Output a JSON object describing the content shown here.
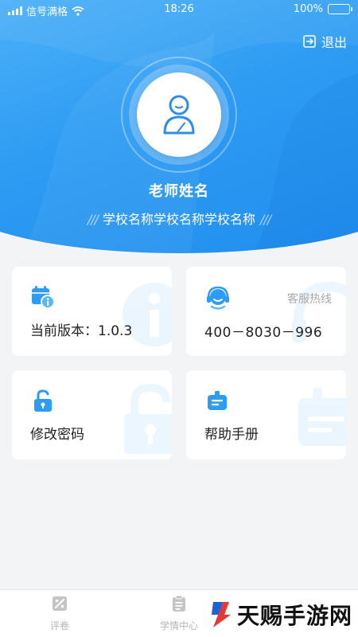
{
  "statusbar": {
    "carrier": "信号满格",
    "time": "18:26",
    "battery": "100%"
  },
  "header": {
    "logout_label": "退出",
    "teacher_name": "老师姓名",
    "school_name": "学校名称学校名称学校名称",
    "slashes_left": "///",
    "slashes_right": "///"
  },
  "cards": {
    "version": {
      "label": "当前版本：1.0.3"
    },
    "hotline": {
      "hint": "客服热线",
      "phone": "400－8030－996"
    },
    "password": {
      "label": "修改密码"
    },
    "manual": {
      "label": "帮助手册"
    }
  },
  "bottom_nav": {
    "items": [
      {
        "label": "评卷",
        "icon": "grading-icon"
      },
      {
        "label": "学情中心",
        "icon": "clipboard-icon"
      }
    ]
  },
  "watermark": {
    "brand_text": "天赐手游网"
  },
  "colors": {
    "primary": "#2e9cf3",
    "card_bg": "#ffffff",
    "page_bg": "#f3f4f6",
    "text_dark": "#222222",
    "text_muted": "#a9a9a9"
  }
}
